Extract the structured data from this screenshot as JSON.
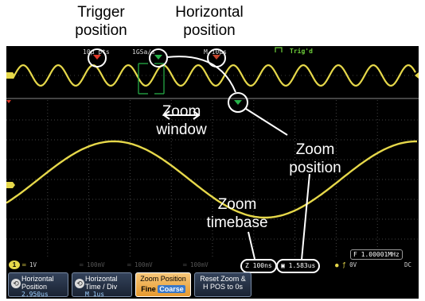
{
  "callouts": {
    "trigger_position": [
      "Trigger",
      "position"
    ],
    "horizontal_position": [
      "Horizontal",
      "position"
    ],
    "zoom_window": [
      "Zoom",
      "window"
    ],
    "zoom_position": [
      "Zoom",
      "position"
    ],
    "zoom_timebase": [
      "Zoom",
      "timebase"
    ]
  },
  "top_bar": {
    "timebase": "10µ pts",
    "sample_rate": "1GSa/s",
    "mode": "M 10µs",
    "trigger_status": "Trig'd"
  },
  "channel_marker": "1",
  "bottom_status": {
    "ch1_scale": "1V",
    "ch2_scale": "100mV",
    "ch3_scale": "100mV",
    "ch4_scale": "100mV",
    "zoom_timebase": "100ns",
    "zoom_position": "1.583us",
    "frequency": "1.00001MHz",
    "trigger_level": "0V",
    "coupling": "DC"
  },
  "softkeys": [
    {
      "label": "Horizontal Position",
      "value": "2.950us"
    },
    {
      "label": "Horizontal Time / Div",
      "value": "M 1us"
    },
    {
      "label": "Zoom Position",
      "fine": "Fine",
      "coarse": "Coarse"
    },
    {
      "label": "Reset Zoom & H POS to 0s"
    }
  ],
  "colors": {
    "screen_bg": "#000000",
    "trace": "#e6d84a",
    "trigger_marker": "#e03a2a",
    "position_marker": "#27b34a",
    "zoom_window": "#27b34a",
    "callout": "#ffffff",
    "active_softkey": "#e79a2f"
  },
  "icons": [
    "trigger-position-arrow-icon",
    "horizontal-position-arrow-icon",
    "zoom-position-arrow-icon",
    "rotary-knob-icon",
    "edge-trigger-icon"
  ]
}
